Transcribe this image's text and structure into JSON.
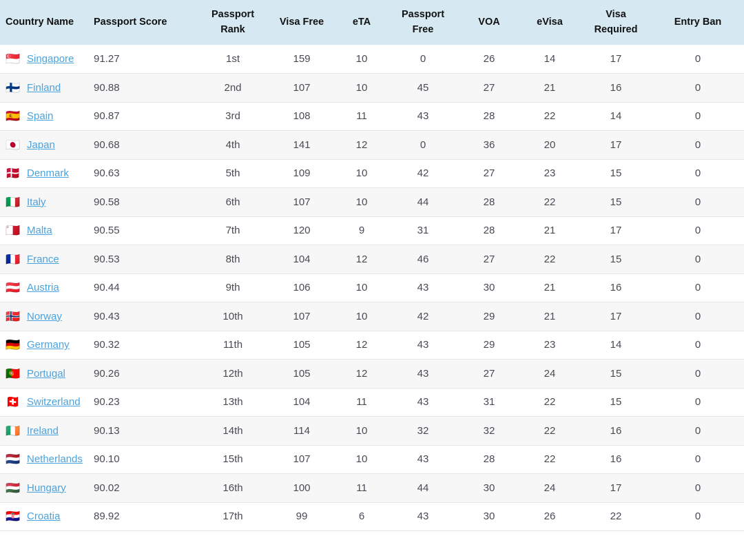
{
  "table": {
    "columns": [
      {
        "key": "country",
        "label": "Country Name"
      },
      {
        "key": "score",
        "label": "Passport Score"
      },
      {
        "key": "rank",
        "label": "Passport Rank"
      },
      {
        "key": "visafree",
        "label": "Visa Free"
      },
      {
        "key": "eta",
        "label": "eTA"
      },
      {
        "key": "pfree",
        "label": "Passport Free"
      },
      {
        "key": "voa",
        "label": "VOA"
      },
      {
        "key": "evisa",
        "label": "eVisa"
      },
      {
        "key": "vreq",
        "label": "Visa Required"
      },
      {
        "key": "ban",
        "label": "Entry Ban"
      }
    ],
    "colors": {
      "header_background": "#d6e9f2",
      "link": "#4aa3df",
      "row_alt_background": "#f7f7f7",
      "row_background": "#ffffff",
      "row_border": "#e6e6e6",
      "text": "#4a4a55"
    },
    "rows": [
      {
        "flag": "🇸🇬",
        "flag_name": "flag-singapore",
        "country": "Singapore",
        "score": "91.27",
        "rank": "1st",
        "visafree": "159",
        "eta": "10",
        "pfree": "0",
        "voa": "26",
        "evisa": "14",
        "vreq": "17",
        "ban": "0"
      },
      {
        "flag": "🇫🇮",
        "flag_name": "flag-finland",
        "country": "Finland",
        "score": "90.88",
        "rank": "2nd",
        "visafree": "107",
        "eta": "10",
        "pfree": "45",
        "voa": "27",
        "evisa": "21",
        "vreq": "16",
        "ban": "0"
      },
      {
        "flag": "🇪🇸",
        "flag_name": "flag-spain",
        "country": "Spain",
        "score": "90.87",
        "rank": "3rd",
        "visafree": "108",
        "eta": "11",
        "pfree": "43",
        "voa": "28",
        "evisa": "22",
        "vreq": "14",
        "ban": "0"
      },
      {
        "flag": "🇯🇵",
        "flag_name": "flag-japan",
        "country": "Japan",
        "score": "90.68",
        "rank": "4th",
        "visafree": "141",
        "eta": "12",
        "pfree": "0",
        "voa": "36",
        "evisa": "20",
        "vreq": "17",
        "ban": "0"
      },
      {
        "flag": "🇩🇰",
        "flag_name": "flag-denmark",
        "country": "Denmark",
        "score": "90.63",
        "rank": "5th",
        "visafree": "109",
        "eta": "10",
        "pfree": "42",
        "voa": "27",
        "evisa": "23",
        "vreq": "15",
        "ban": "0"
      },
      {
        "flag": "🇮🇹",
        "flag_name": "flag-italy",
        "country": "Italy",
        "score": "90.58",
        "rank": "6th",
        "visafree": "107",
        "eta": "10",
        "pfree": "44",
        "voa": "28",
        "evisa": "22",
        "vreq": "15",
        "ban": "0"
      },
      {
        "flag": "🇲🇹",
        "flag_name": "flag-malta",
        "country": "Malta",
        "score": "90.55",
        "rank": "7th",
        "visafree": "120",
        "eta": "9",
        "pfree": "31",
        "voa": "28",
        "evisa": "21",
        "vreq": "17",
        "ban": "0"
      },
      {
        "flag": "🇫🇷",
        "flag_name": "flag-france",
        "country": "France",
        "score": "90.53",
        "rank": "8th",
        "visafree": "104",
        "eta": "12",
        "pfree": "46",
        "voa": "27",
        "evisa": "22",
        "vreq": "15",
        "ban": "0"
      },
      {
        "flag": "🇦🇹",
        "flag_name": "flag-austria",
        "country": "Austria",
        "score": "90.44",
        "rank": "9th",
        "visafree": "106",
        "eta": "10",
        "pfree": "43",
        "voa": "30",
        "evisa": "21",
        "vreq": "16",
        "ban": "0"
      },
      {
        "flag": "🇳🇴",
        "flag_name": "flag-norway",
        "country": "Norway",
        "score": "90.43",
        "rank": "10th",
        "visafree": "107",
        "eta": "10",
        "pfree": "42",
        "voa": "29",
        "evisa": "21",
        "vreq": "17",
        "ban": "0"
      },
      {
        "flag": "🇩🇪",
        "flag_name": "flag-germany",
        "country": "Germany",
        "score": "90.32",
        "rank": "11th",
        "visafree": "105",
        "eta": "12",
        "pfree": "43",
        "voa": "29",
        "evisa": "23",
        "vreq": "14",
        "ban": "0"
      },
      {
        "flag": "🇵🇹",
        "flag_name": "flag-portugal",
        "country": "Portugal",
        "score": "90.26",
        "rank": "12th",
        "visafree": "105",
        "eta": "12",
        "pfree": "43",
        "voa": "27",
        "evisa": "24",
        "vreq": "15",
        "ban": "0"
      },
      {
        "flag": "🇨🇭",
        "flag_name": "flag-switzerland",
        "country": "Switzerland",
        "score": "90.23",
        "rank": "13th",
        "visafree": "104",
        "eta": "11",
        "pfree": "43",
        "voa": "31",
        "evisa": "22",
        "vreq": "15",
        "ban": "0"
      },
      {
        "flag": "🇮🇪",
        "flag_name": "flag-ireland",
        "country": "Ireland",
        "score": "90.13",
        "rank": "14th",
        "visafree": "114",
        "eta": "10",
        "pfree": "32",
        "voa": "32",
        "evisa": "22",
        "vreq": "16",
        "ban": "0"
      },
      {
        "flag": "🇳🇱",
        "flag_name": "flag-netherlands",
        "country": "Netherlands",
        "score": "90.10",
        "rank": "15th",
        "visafree": "107",
        "eta": "10",
        "pfree": "43",
        "voa": "28",
        "evisa": "22",
        "vreq": "16",
        "ban": "0"
      },
      {
        "flag": "🇭🇺",
        "flag_name": "flag-hungary",
        "country": "Hungary",
        "score": "90.02",
        "rank": "16th",
        "visafree": "100",
        "eta": "11",
        "pfree": "44",
        "voa": "30",
        "evisa": "24",
        "vreq": "17",
        "ban": "0"
      },
      {
        "flag": "🇭🇷",
        "flag_name": "flag-croatia",
        "country": "Croatia",
        "score": "89.92",
        "rank": "17th",
        "visafree": "99",
        "eta": "6",
        "pfree": "43",
        "voa": "30",
        "evisa": "26",
        "vreq": "22",
        "ban": "0"
      }
    ]
  }
}
